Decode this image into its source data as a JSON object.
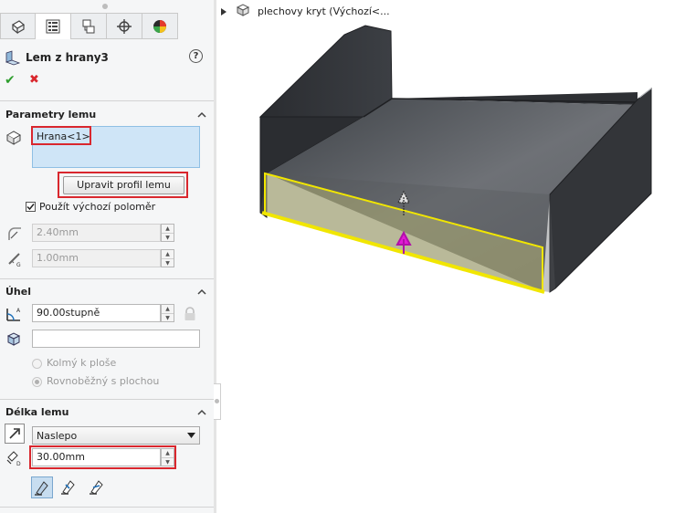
{
  "feature": {
    "title": "Lem z hrany3"
  },
  "tabs": [
    "feature-manager",
    "property-manager",
    "configuration-manager",
    "dimxpert",
    "display-manager"
  ],
  "confirm": {
    "ok_symbol": "✔",
    "cancel_symbol": "✖"
  },
  "help_symbol": "?",
  "params": {
    "title": "Parametry lemu",
    "edge_item": "Hrana<1>",
    "edit_profile_button": "Upravit profil lemu",
    "use_default_radius_label": "Použít výchozí poloměr",
    "radius_value": "2.40mm",
    "gap_value": "1.00mm"
  },
  "angle": {
    "title": "Úhel",
    "angle_value": "90.00stupně",
    "reference_value": "",
    "perpendicular_label": "Kolmý k ploše",
    "parallel_label": "Rovnoběžný s plochou"
  },
  "length": {
    "title": "Délka lemu",
    "end_condition": "Naslepo",
    "length_value": "30.00mm"
  },
  "tree": {
    "root_label": "plechovy kryt  (Výchozí<..."
  },
  "colors": {
    "highlight": "#d9272e",
    "selection": "#cfe5f7",
    "accept": "#2e9e2e",
    "reject": "#d9272e",
    "preview": "#f1e600"
  }
}
